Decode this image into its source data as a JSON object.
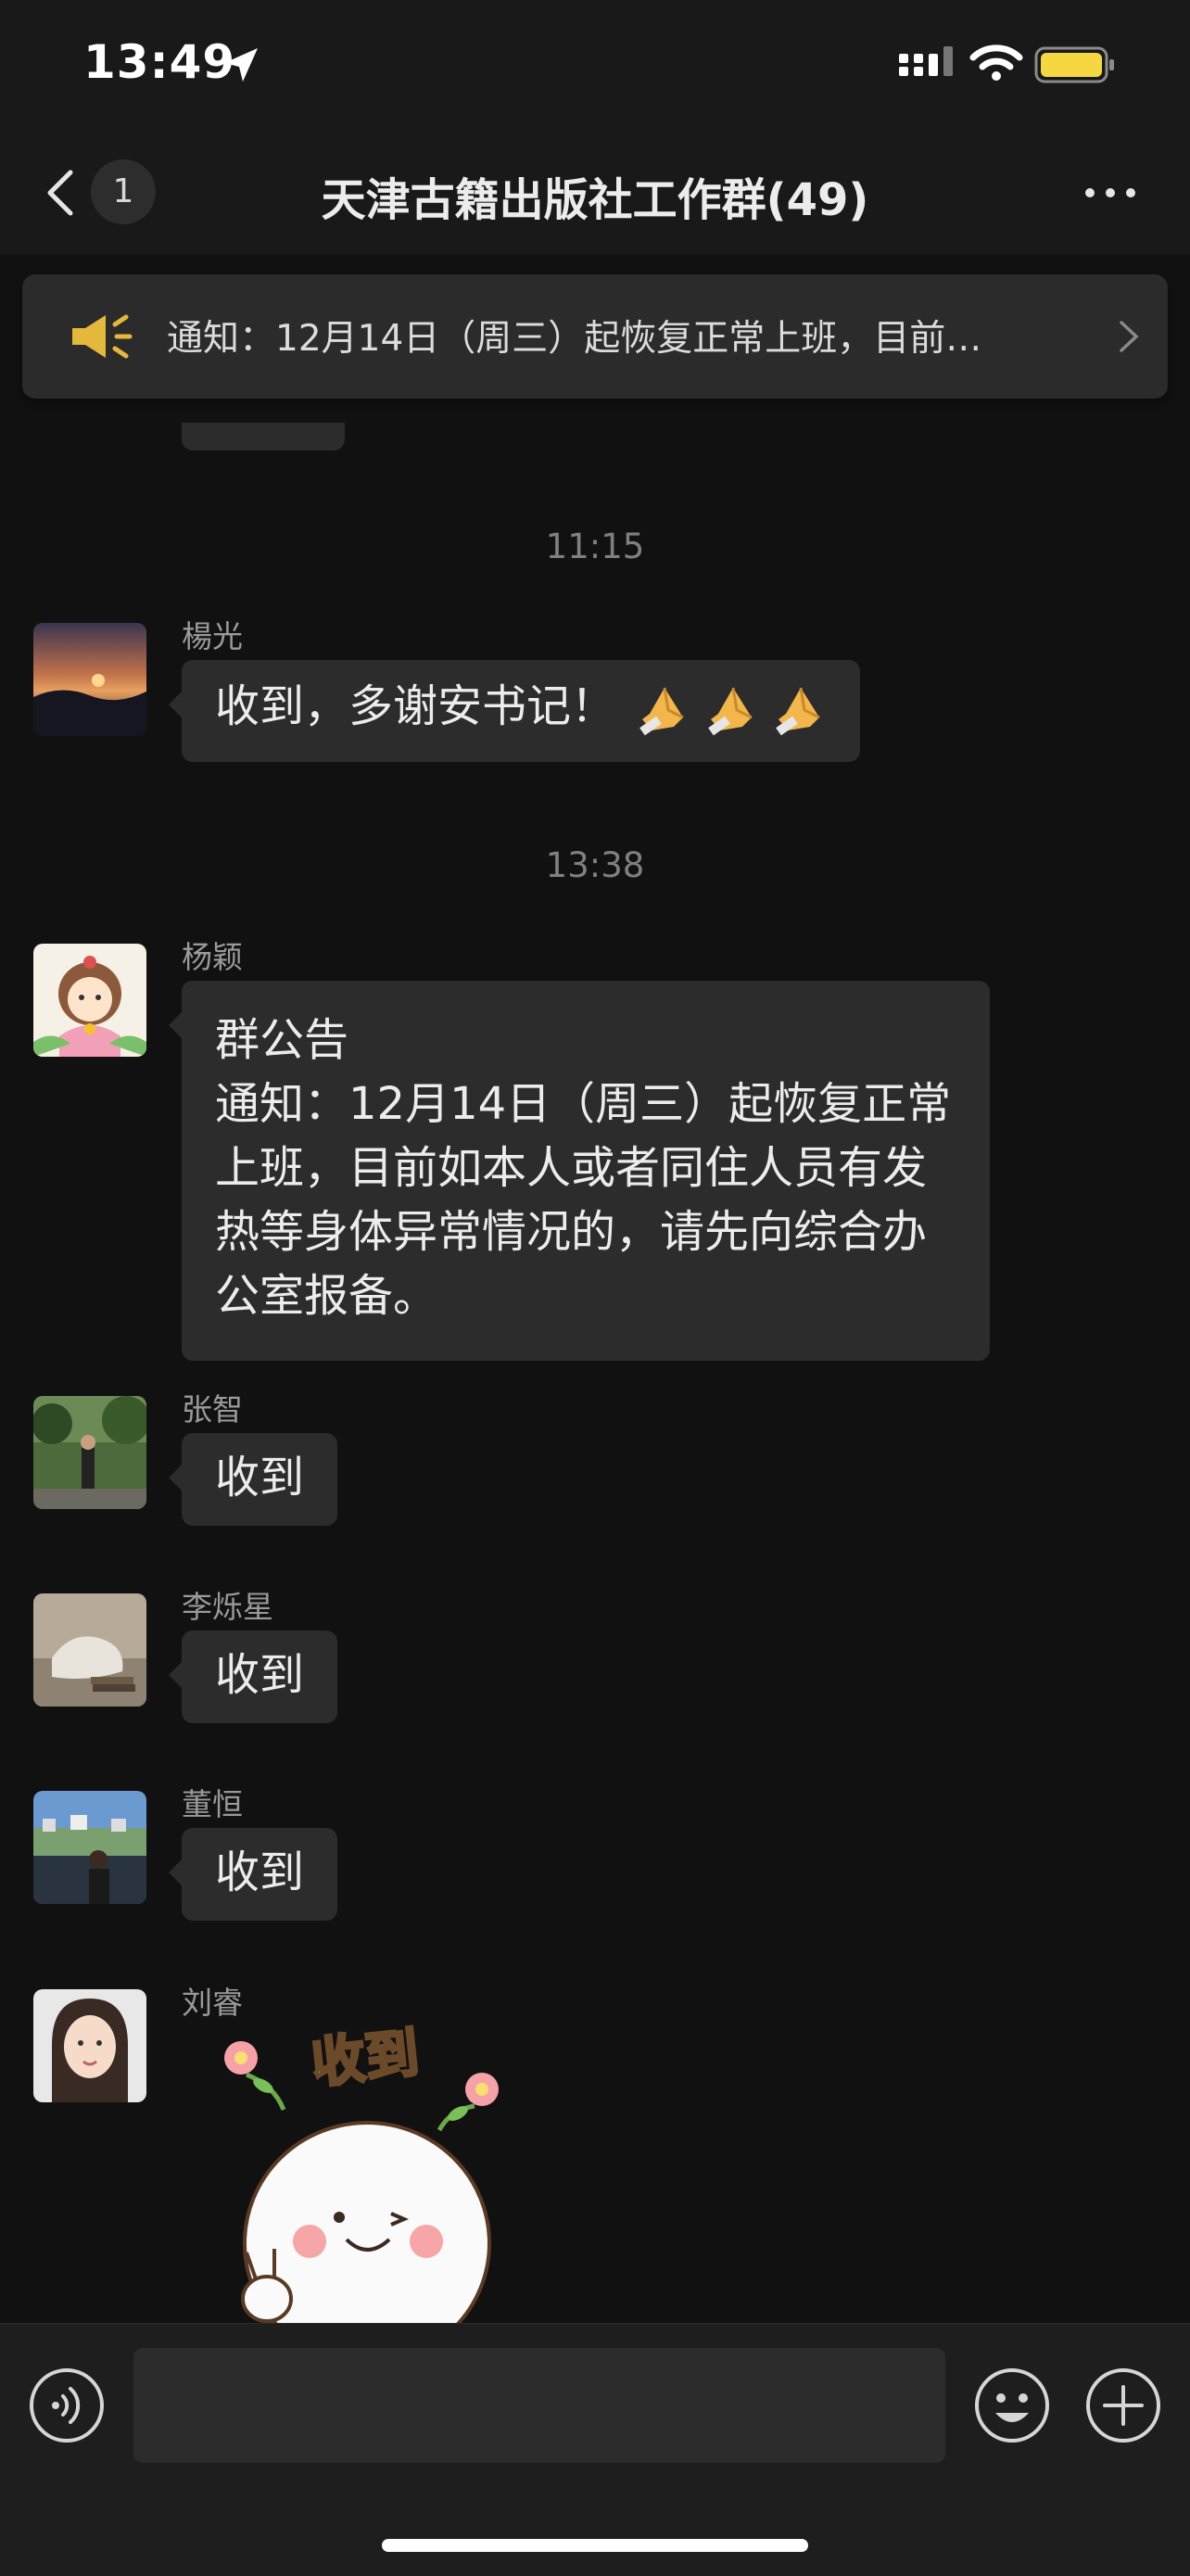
{
  "status_bar": {
    "time": "13:49"
  },
  "nav": {
    "unread_count": "1",
    "title": "天津古籍出版社工作群(49)"
  },
  "notice": {
    "text": "通知：12月14日（周三）起恢复正常上班，目前…"
  },
  "timestamps": [
    "11:15",
    "13:38"
  ],
  "messages": [
    {
      "sender": "楊光",
      "text": "收到，多谢安书记！"
    },
    {
      "sender": "杨颖",
      "lines": [
        "群公告",
        "通知：12月14日（周三）起恢复正常上班，目前如本人或者同住人员有发热等身体异常情况的，请先向综合办公室报备。"
      ]
    },
    {
      "sender": "张智",
      "text": "收到"
    },
    {
      "sender": "李烁星",
      "text": "收到"
    },
    {
      "sender": "董恒",
      "text": "收到"
    },
    {
      "sender": "刘睿",
      "sticker_text": "收到"
    }
  ],
  "icons": {
    "location": "location-arrow-icon",
    "cellular": "cellular-signal-icon",
    "wifi": "wifi-icon",
    "battery": "battery-icon",
    "back": "chevron-left-icon",
    "more": "more-dots-icon",
    "announcement": "speaker-icon",
    "notice_chevron": "chevron-right-icon",
    "emoji": "pray-hands-emoji",
    "voice": "voice-input-icon",
    "smiley": "smiley-icon",
    "plus": "plus-icon"
  },
  "colors": {
    "background": "#111111",
    "bar": "#191919",
    "bubble": "#2c2c2c",
    "battery": "#f5d742",
    "speaker": "#e4b83a"
  }
}
